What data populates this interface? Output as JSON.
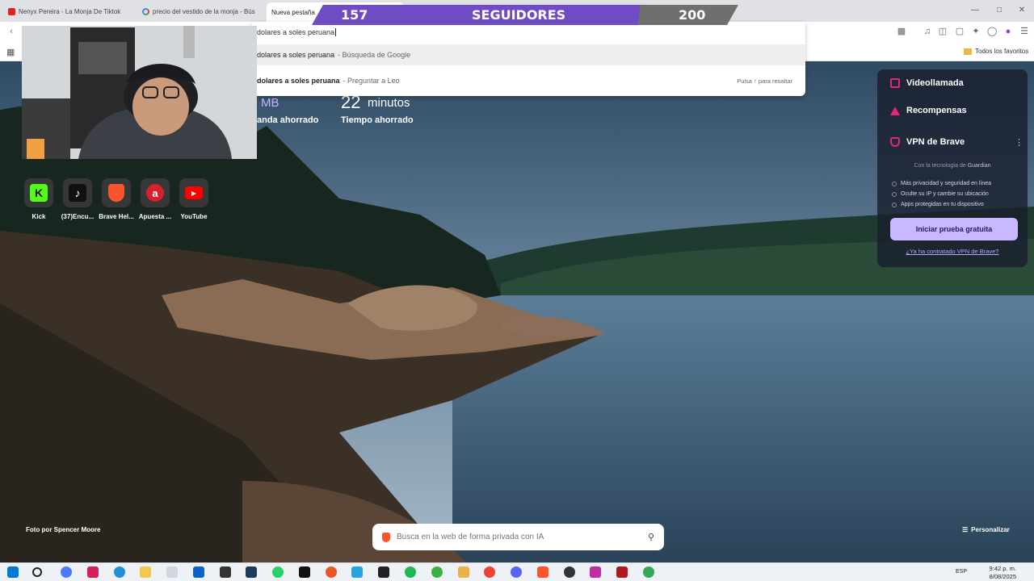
{
  "tabs": [
    {
      "title": "Nenyx Pereira - La Monja De Tiktok",
      "icon": "youtube-favicon"
    },
    {
      "title": "precio del vestido de la monja - Bús",
      "icon": "google-favicon"
    },
    {
      "title": "Nueva pestaña",
      "icon": "none"
    }
  ],
  "omnibox": {
    "typed": "dolares a soles peruana",
    "suggestions": [
      {
        "query": "dolares a soles peruana",
        "suffix": "- Búsqueda de Google"
      },
      {
        "query": "dolares a soles peruana",
        "suffix": "- Preguntar a Leo",
        "hint": "Pulsa ↑ para resaltar"
      }
    ]
  },
  "bookmarks": {
    "all_label": "Todos los favoritos"
  },
  "stats": {
    "bandwidth_unit": "MB",
    "bandwidth_label": "anda ahorrado",
    "time_value": "22",
    "time_unit": "minutos",
    "time_label": "Tiempo ahorrado"
  },
  "overlay": {
    "current": "157",
    "label": "SEGUIDORES",
    "goal": "200",
    "progress": 0.785
  },
  "top_sites": [
    {
      "name": "Kick",
      "icon": "kick-icon",
      "color": "#53fc18"
    },
    {
      "name": "(37)Encu...",
      "icon": "tiktok-icon",
      "color": "#111111"
    },
    {
      "name": "Brave Hel...",
      "icon": "brave-icon",
      "color": "#fb542b"
    },
    {
      "name": "Apuesta ...",
      "icon": "apuesta-icon",
      "color": "#d6202a"
    },
    {
      "name": "YouTube",
      "icon": "youtube-icon",
      "color": "#ff0000"
    }
  ],
  "panel": {
    "video_call": "Videollamada",
    "rewards": "Recompensas",
    "vpn_title": "VPN de Brave",
    "vpn_tech": "Con la tecnología de",
    "vpn_partner": "Guardian",
    "features": [
      "Más privacidad y seguridad en línea",
      "Oculte su IP y cambie su ubicación",
      "Apps protegidas en tu dispositivo"
    ],
    "trial_button": "Iniciar prueba gratuita",
    "contracted_link": "¿Ya ha contratado VPN de Brave?"
  },
  "photo_credit": "Foto por Spencer Moore",
  "search": {
    "placeholder": "Busca en la web de forma privada con IA"
  },
  "customize_label": "Personalizar",
  "taskbar": {
    "lang": "ESP",
    "time": "9:42 p. m.",
    "date": "8/08/2025"
  }
}
